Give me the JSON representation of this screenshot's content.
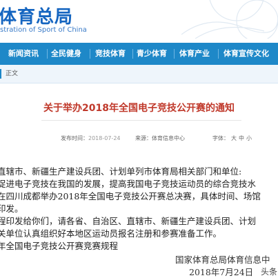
{
  "header": {
    "logo_text": "体育总局",
    "logo_subtitle": "stration of Sport of China"
  },
  "nav": {
    "items": [
      {
        "label": "新闻资讯"
      },
      {
        "label": "全民健身"
      },
      {
        "label": "竞技体育"
      },
      {
        "label": "青少体育"
      },
      {
        "label": "体育产业"
      },
      {
        "label": "体育宣传文化"
      }
    ]
  },
  "breadcrumb": {
    "current": "正文"
  },
  "article": {
    "title": "关于举办2018年全国电子竞技公开赛的通知",
    "meta": {
      "date_label": "发布时间：",
      "date_value": "2018-07-24",
      "source_label": "来源：",
      "source_value": "体育信息中心",
      "fontsize_label": "字体：",
      "fontsize_options": [
        "大",
        "中",
        "小"
      ]
    },
    "lines": [
      "直辖市、新疆生产建设兵团、计划单列市体育局相关部门和单位:",
      "促进电子竞技在我国的发展，提高我国电子竞技运动员的综合竞技水",
      "在四川成都举办2018年全国电子竞技公开赛总决赛，具体时间、场馆",
      "印发。",
      "程印发给你们，请各省、自治区、直辖市、新疆生产建设兵团、计划",
      "关单位认真组织好本地区运动员报名注册和参赛准备工作。",
      "年全国电子竞技公开赛竞赛规程"
    ],
    "signature": "国家体育总局体育信息中",
    "date": "2018年7月24日"
  },
  "watermark": "头条"
}
